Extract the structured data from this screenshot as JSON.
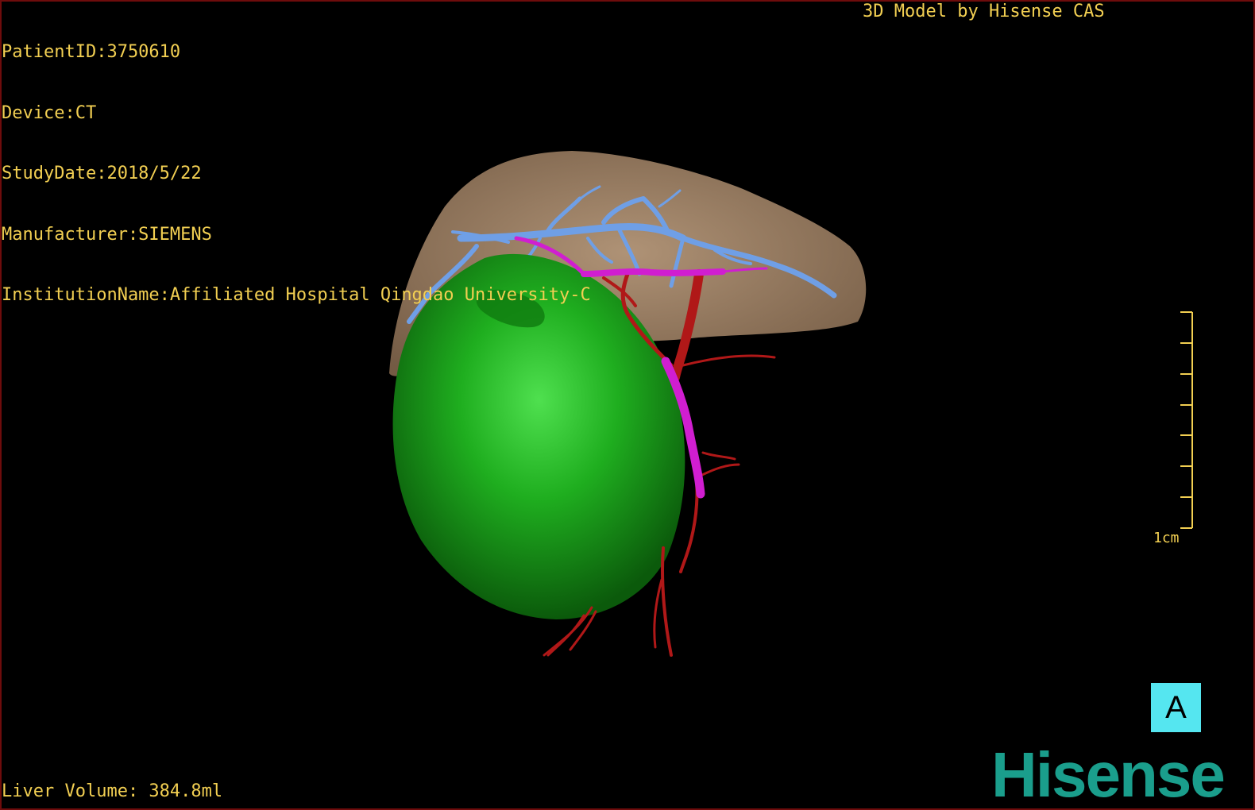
{
  "overlay": {
    "patient_id": "PatientID:3750610",
    "device": "Device:CT",
    "study_date": "StudyDate:2018/5/22",
    "manufacturer": "Manufacturer:SIEMENS",
    "institution": "InstitutionName:Affiliated Hospital Qingdao University-C",
    "model_credit": "3D Model by Hisense CAS",
    "liver_volume": "Liver Volume: 384.8ml"
  },
  "scale_bar": {
    "label": "1cm"
  },
  "orientation": {
    "label": "A",
    "color": "#55e6f0"
  },
  "brand": {
    "logo_text": "Hisense",
    "color": "#1a9e8c"
  },
  "colors": {
    "text": "#f2cf52",
    "liver": "#a8896a",
    "tumor": "#1fae1f",
    "portal_vein": "#6f9fe6",
    "artery": "#b01818",
    "hepatic_vein": "#d01ed0",
    "border": "#6e0c0c"
  }
}
